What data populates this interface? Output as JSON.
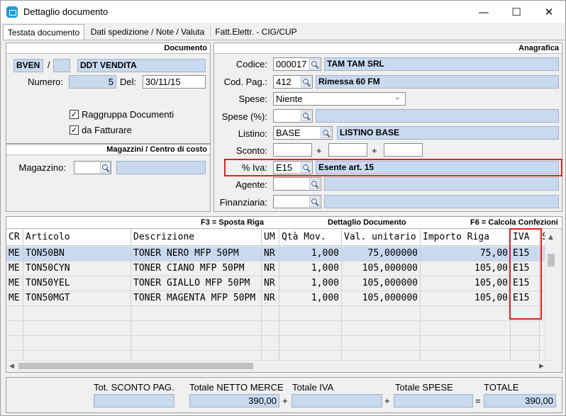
{
  "window": {
    "title": "Dettaglio documento",
    "minimize": "—",
    "maximize": "☐",
    "close": "✕"
  },
  "tabs": [
    {
      "label": "Testata documento"
    },
    {
      "label": "Dati spedizione / Note / Valuta"
    },
    {
      "label": "Fatt.Elettr. - CIG/CUP"
    }
  ],
  "documento": {
    "header": "Documento",
    "tipo": "BVEN",
    "slash": "/",
    "serie": "",
    "descrizione": "DDT VENDITA",
    "numero_label": "Numero:",
    "numero": "5",
    "del_label": "Del:",
    "data": "30/11/15",
    "raggruppa_label": "Raggruppa Documenti",
    "raggruppa_checked": "✓",
    "fatturare_label": "da Fatturare",
    "fatturare_checked": "✓"
  },
  "magazzini": {
    "header": "Magazzini / Centro di costo",
    "magazzino_label": "Magazzino:",
    "magazzino": "",
    "descrizione": ""
  },
  "anagrafica": {
    "header": "Anagrafica",
    "codice_label": "Codice:",
    "codice": "000017",
    "codice_desc": "TAM TAM SRL",
    "codpag_label": "Cod. Pag.:",
    "codpag": "412",
    "codpag_desc": "Rimessa 60 FM",
    "spese_label": "Spese:",
    "spese": "Niente",
    "spese_perc_label": "Spese (%):",
    "spese_perc": "",
    "listino_label": "Listino:",
    "listino": "BASE",
    "listino_desc": "LISTINO BASE",
    "sconto_label": "Sconto:",
    "plus": "+",
    "iva_label": "% Iva:",
    "iva": "E15",
    "iva_desc": "Esente art. 15",
    "agente_label": "Agente:",
    "finanziaria_label": "Finanziaria:"
  },
  "dettaglio": {
    "hint_left": "F3 = Sposta Riga",
    "title": "Dettaglio Documento",
    "hint_right": "F6 = Calcola Confezioni",
    "columns": [
      "CR",
      "Articolo",
      "Descrizione",
      "UM",
      "Qtà Mov.",
      "Val. unitario",
      "Importo Riga",
      "IVA",
      "Sc"
    ],
    "rows": [
      {
        "cr": "ME",
        "articolo": "TON50BN",
        "descrizione": "TONER NERO MFP 50PM",
        "um": "NR",
        "qta": "1,000",
        "val": "75,000000",
        "importo": "75,00",
        "iva": "E15"
      },
      {
        "cr": "ME",
        "articolo": "TON50CYN",
        "descrizione": "TONER CIANO MFP 50PM",
        "um": "NR",
        "qta": "1,000",
        "val": "105,000000",
        "importo": "105,00",
        "iva": "E15"
      },
      {
        "cr": "ME",
        "articolo": "TON50YEL",
        "descrizione": "TONER GIALLO MFP 50PM",
        "um": "NR",
        "qta": "1,000",
        "val": "105,000000",
        "importo": "105,00",
        "iva": "E15"
      },
      {
        "cr": "ME",
        "articolo": "TON50MGT",
        "descrizione": "TONER MAGENTA MFP 50PM",
        "um": "NR",
        "qta": "1,000",
        "val": "105,000000",
        "importo": "105,00",
        "iva": "E15"
      }
    ]
  },
  "totali": {
    "sconto_label": "Tot. SCONTO PAG.",
    "sconto": "",
    "netto_label": "Totale NETTO MERCE",
    "netto": "390,00",
    "iva_label": "Totale IVA",
    "iva": "",
    "spese_label": "Totale SPESE",
    "spese": "",
    "totale_label": "TOTALE",
    "totale": "390,00",
    "op_plus": "+",
    "op_eq": "="
  },
  "colors": {
    "readonly": "#c9d9ef",
    "highlight": "#e02020"
  }
}
